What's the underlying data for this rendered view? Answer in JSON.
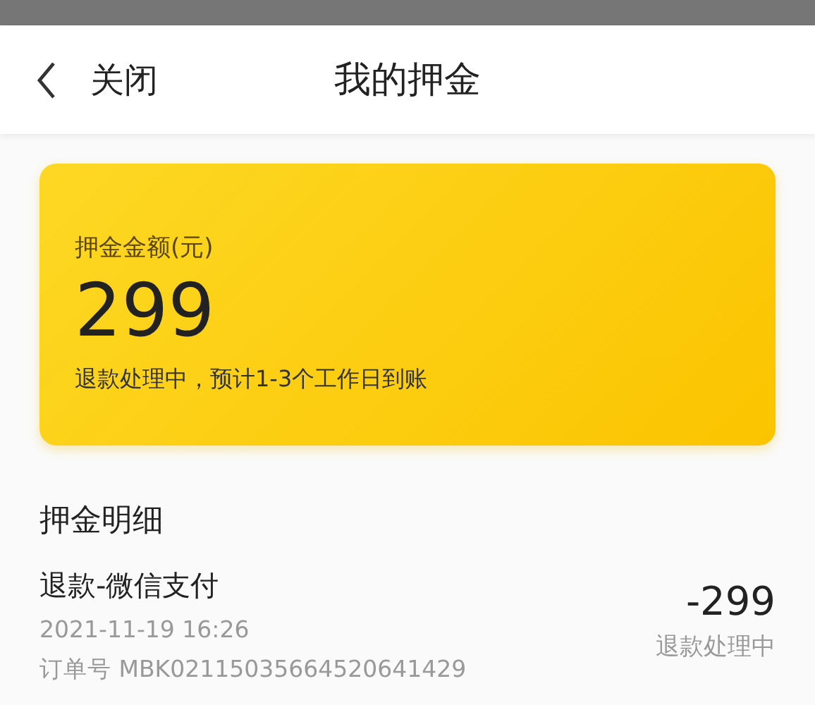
{
  "header": {
    "back_label": "关闭",
    "title": "我的押金"
  },
  "deposit_card": {
    "label": "押金金额(元)",
    "amount": "299",
    "note": "退款处理中，预计1-3个工作日到账"
  },
  "details": {
    "title": "押金明细",
    "records": [
      {
        "name": "退款-微信支付",
        "time": "2021-11-19 16:26",
        "order": "订单号 MBK02115035664520641429",
        "amount": "-299",
        "status": "退款处理中"
      }
    ]
  }
}
